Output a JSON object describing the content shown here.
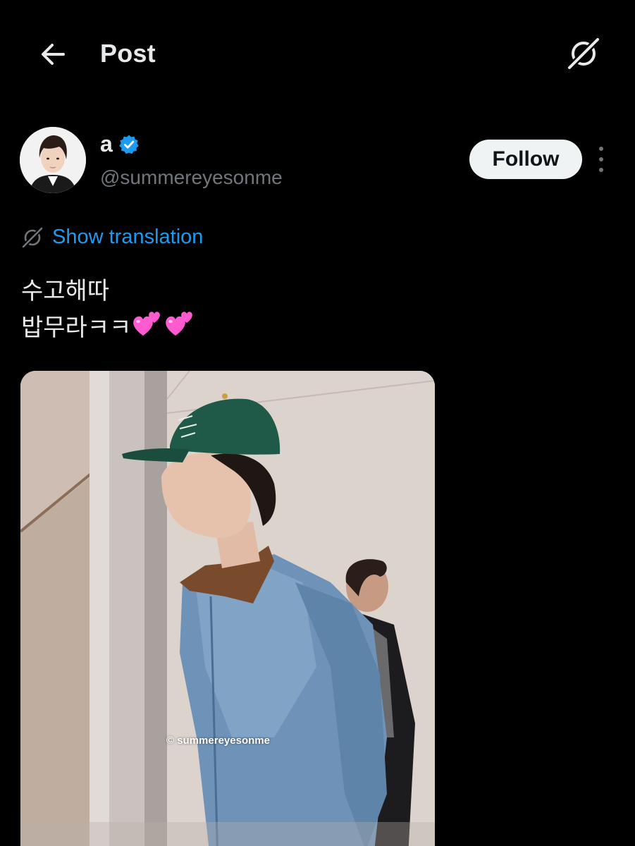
{
  "header": {
    "title": "Post",
    "back_icon": "arrow-left-icon",
    "grok_icon": "grok-icon"
  },
  "author": {
    "display_name": "a",
    "handle": "@summereyesonme",
    "verified": true,
    "verified_color": "#1d9bf0",
    "follow_label": "Follow"
  },
  "translation": {
    "label": "Show translation",
    "color": "#1d9bf0"
  },
  "post": {
    "line1": "수고해따",
    "line2": "밥무라ㅋㅋ",
    "emoji": [
      "two-hearts",
      "two-hearts"
    ]
  },
  "media": {
    "watermark": "© summereyesonme"
  },
  "colors": {
    "background": "#000000",
    "text_primary": "#e7e9ea",
    "text_secondary": "#71767b",
    "accent": "#1d9bf0"
  }
}
